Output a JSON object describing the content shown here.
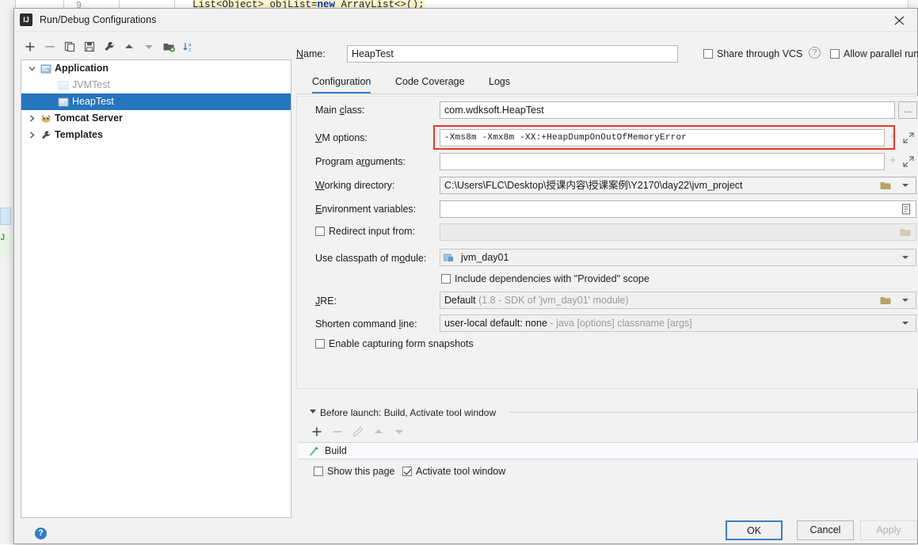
{
  "editor_background": {
    "line_number": "9",
    "code": "List<Object> objList=new ArrayList<>();",
    "code_before_kw": "List<Object> objList=",
    "code_keyword": "new",
    "code_after_kw": " ArrayList<>();"
  },
  "dialog": {
    "title": "Run/Debug Configurations",
    "app_icon_text": "IJ",
    "close_label": "×"
  },
  "left_toolbar": {
    "buttons": [
      {
        "name": "add-configuration-button",
        "tooltip": "Add New Configuration",
        "glyph": "+"
      },
      {
        "name": "remove-configuration-button",
        "tooltip": "Remove Configuration",
        "glyph": "−"
      },
      {
        "name": "copy-configuration-button",
        "tooltip": "Copy Configuration",
        "glyph": "copy"
      },
      {
        "name": "save-configuration-button",
        "tooltip": "Save Configuration",
        "glyph": "save"
      },
      {
        "name": "edit-templates-button",
        "tooltip": "Edit Templates",
        "glyph": "wrench"
      },
      {
        "name": "move-up-button",
        "tooltip": "Move Up",
        "glyph": "up"
      },
      {
        "name": "move-down-button",
        "tooltip": "Move Down",
        "glyph": "down"
      },
      {
        "name": "move-into-folder-button",
        "tooltip": "Create New Folder",
        "glyph": "folder-plus"
      },
      {
        "name": "sort-configurations-button",
        "tooltip": "Sort Configurations",
        "glyph": "sort-az"
      }
    ]
  },
  "tree": {
    "items": [
      {
        "label": "Application",
        "level": 0,
        "bold": true,
        "dim": false,
        "expanded": true,
        "has_arrow": true,
        "selected": false,
        "icon": "application-icon"
      },
      {
        "label": "JVMTest",
        "level": 1,
        "bold": false,
        "dim": true,
        "expanded": false,
        "has_arrow": false,
        "selected": false,
        "icon": "config-icon"
      },
      {
        "label": "HeapTest",
        "level": 1,
        "bold": false,
        "dim": false,
        "expanded": false,
        "has_arrow": false,
        "selected": true,
        "icon": "config-icon"
      },
      {
        "label": "Tomcat Server",
        "level": 0,
        "bold": true,
        "dim": false,
        "expanded": false,
        "has_arrow": true,
        "selected": false,
        "icon": "tomcat-icon"
      },
      {
        "label": "Templates",
        "level": 0,
        "bold": true,
        "dim": false,
        "expanded": false,
        "has_arrow": true,
        "selected": false,
        "icon": "wrench-icon"
      }
    ]
  },
  "header": {
    "name_label": "Name:",
    "name_value": "HeapTest",
    "share_vcs_label": "Share through VCS",
    "share_vcs_checked": false,
    "allow_parallel_label": "Allow parallel run",
    "allow_parallel_checked": false,
    "help_glyph": "?"
  },
  "tabs": [
    {
      "label": "Configuration",
      "active": true
    },
    {
      "label": "Code Coverage",
      "active": false
    },
    {
      "label": "Logs",
      "active": false
    }
  ],
  "form": {
    "main_class_label": "Main class:",
    "main_class_value": "com.wdksoft.HeapTest",
    "main_class_browse": "...",
    "vm_options_label": "VM options:",
    "vm_options_value": "-Xms8m -Xmx8m -XX:+HeapDumpOnOutOfMemoryError",
    "vm_options_highlight_color": "#e8352a",
    "program_args_label": "Program arguments:",
    "program_args_value": "",
    "working_dir_label": "Working directory:",
    "working_dir_value": "C:\\Users\\FLC\\Desktop\\授课内容\\授课案例\\Y2170\\day22\\jvm_project",
    "env_vars_label": "Environment variables:",
    "env_vars_value": "",
    "redirect_input_label": "Redirect input from:",
    "redirect_input_checked": false,
    "redirect_input_value": "",
    "classpath_label": "Use classpath of module:",
    "classpath_value": "jvm_day01",
    "include_provided_label": "Include dependencies with \"Provided\" scope",
    "include_provided_checked": false,
    "jre_label": "JRE:",
    "jre_value": "Default",
    "jre_hint": "(1.8 - SDK of 'jvm_day01' module)",
    "shorten_cmd_label": "Shorten command line:",
    "shorten_cmd_value": "user-local default: none",
    "shorten_cmd_hint": "- java [options] classname [args]",
    "form_snapshots_label": "Enable capturing form snapshots",
    "form_snapshots_checked": false
  },
  "before_launch": {
    "header": "Before launch: Build, Activate tool window",
    "toolbar": [
      {
        "name": "bl-add-button",
        "glyph": "+",
        "enabled": true
      },
      {
        "name": "bl-remove-button",
        "glyph": "−",
        "enabled": false
      },
      {
        "name": "bl-edit-button",
        "glyph": "pencil",
        "enabled": false
      },
      {
        "name": "bl-move-up-button",
        "glyph": "up",
        "enabled": false
      },
      {
        "name": "bl-move-down-button",
        "glyph": "down",
        "enabled": false
      }
    ],
    "tasks": [
      {
        "label": "Build",
        "icon": "hammer-icon"
      }
    ],
    "show_page_label": "Show this page",
    "show_page_checked": false,
    "activate_window_label": "Activate tool window",
    "activate_window_checked": true
  },
  "footer": {
    "ok_label": "OK",
    "cancel_label": "Cancel",
    "apply_label": "Apply",
    "apply_enabled": false,
    "help_glyph": "?"
  }
}
